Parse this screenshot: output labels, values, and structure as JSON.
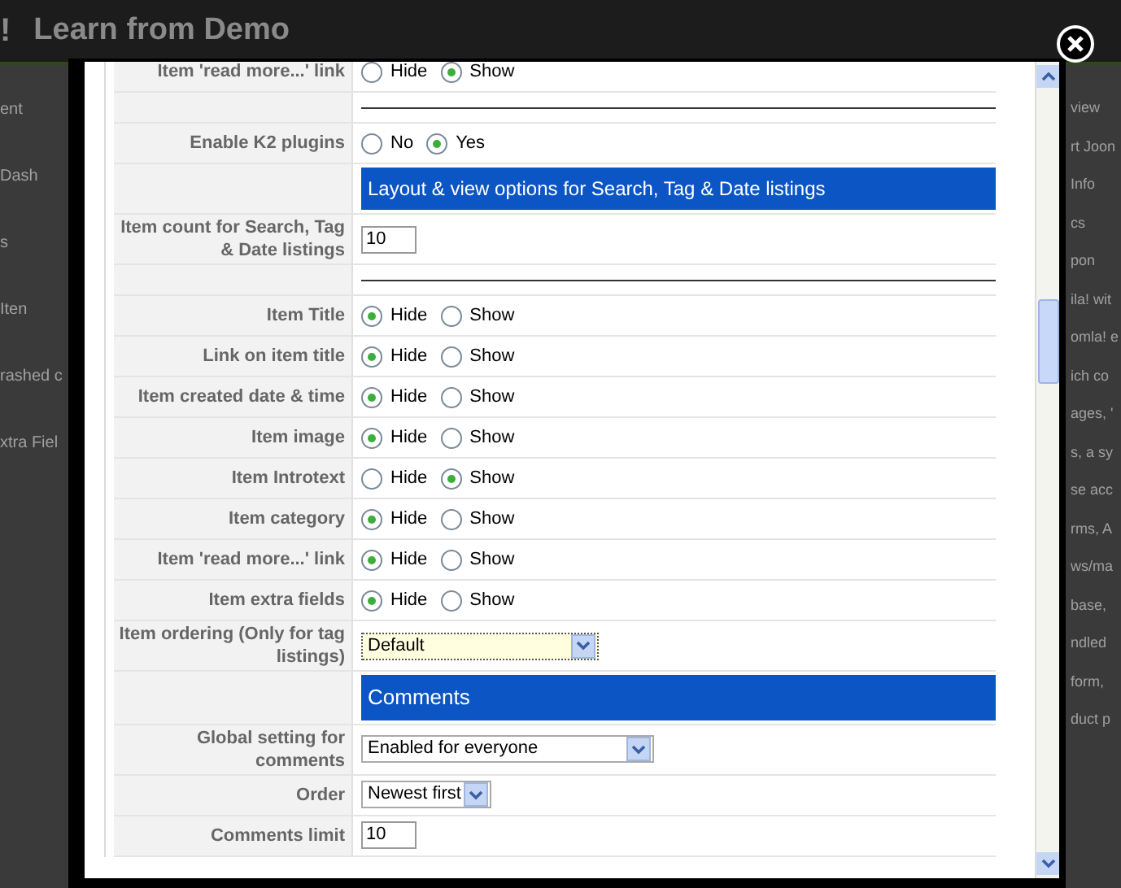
{
  "background": {
    "logo_fragment": "!",
    "title": "Learn from Demo",
    "left_fragments": [
      "ent",
      "Dash",
      "s",
      "Iten",
      "rashed c",
      "xtra Fiel"
    ],
    "right_fragments": [
      "view",
      "rt Joon",
      "Info",
      "cs",
      "pon",
      "ila! wit",
      "omla! e",
      "ich co",
      "ages, '",
      "s, a sy",
      "se acc",
      "rms, A",
      "ws/ma",
      "base,",
      "ndled",
      "form,",
      "duct p"
    ]
  },
  "modal": {
    "rows": [
      {
        "kind": "radio",
        "label": "Item 'read more...' link",
        "options": [
          {
            "label": "Hide",
            "selected": false
          },
          {
            "label": "Show",
            "selected": true
          }
        ]
      },
      {
        "kind": "divider"
      },
      {
        "kind": "radio",
        "label": "Enable K2 plugins",
        "options": [
          {
            "label": "No",
            "selected": false
          },
          {
            "label": "Yes",
            "selected": true
          }
        ]
      },
      {
        "kind": "heading",
        "text": "Layout & view options for Search, Tag & Date listings"
      },
      {
        "kind": "text",
        "label": "Item count for Search, Tag & Date listings",
        "value": "10"
      },
      {
        "kind": "divider"
      },
      {
        "kind": "radio",
        "label": "Item Title",
        "options": [
          {
            "label": "Hide",
            "selected": true
          },
          {
            "label": "Show",
            "selected": false
          }
        ]
      },
      {
        "kind": "radio",
        "label": "Link on item title",
        "options": [
          {
            "label": "Hide",
            "selected": true
          },
          {
            "label": "Show",
            "selected": false
          }
        ]
      },
      {
        "kind": "radio",
        "label": "Item created date & time",
        "options": [
          {
            "label": "Hide",
            "selected": true
          },
          {
            "label": "Show",
            "selected": false
          }
        ]
      },
      {
        "kind": "radio",
        "label": "Item image",
        "options": [
          {
            "label": "Hide",
            "selected": true
          },
          {
            "label": "Show",
            "selected": false
          }
        ]
      },
      {
        "kind": "radio",
        "label": "Item Introtext",
        "options": [
          {
            "label": "Hide",
            "selected": false
          },
          {
            "label": "Show",
            "selected": true
          }
        ]
      },
      {
        "kind": "radio",
        "label": "Item category",
        "options": [
          {
            "label": "Hide",
            "selected": true
          },
          {
            "label": "Show",
            "selected": false
          }
        ]
      },
      {
        "kind": "radio",
        "label": "Item 'read more...' link",
        "options": [
          {
            "label": "Hide",
            "selected": true
          },
          {
            "label": "Show",
            "selected": false
          }
        ]
      },
      {
        "kind": "radio",
        "label": "Item extra fields",
        "options": [
          {
            "label": "Hide",
            "selected": true
          },
          {
            "label": "Show",
            "selected": false
          }
        ]
      },
      {
        "kind": "select",
        "label": "Item ordering (Only for tag listings)",
        "value": "Default",
        "focused": true
      },
      {
        "kind": "heading",
        "text": "Comments"
      },
      {
        "kind": "select",
        "label": "Global setting for comments",
        "value": "Enabled for everyone",
        "focused": false
      },
      {
        "kind": "select",
        "label": "Order",
        "value": "Newest first",
        "focused": false
      },
      {
        "kind": "text",
        "label": "Comments limit",
        "value": "10"
      }
    ]
  }
}
